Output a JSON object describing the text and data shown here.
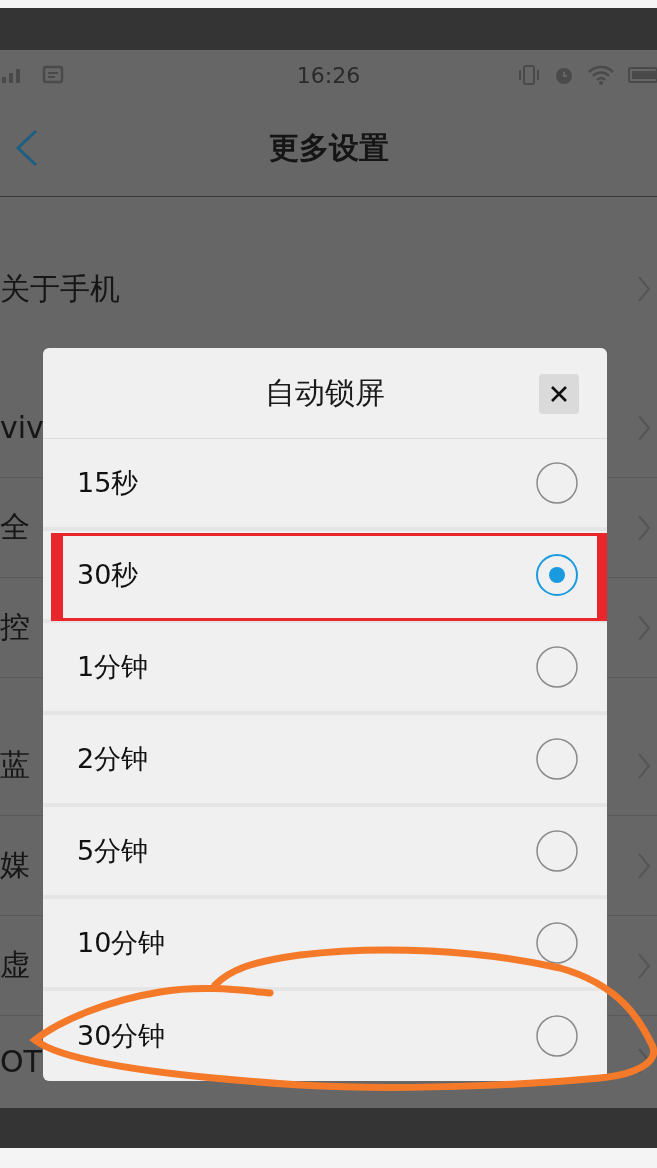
{
  "status_bar": {
    "time": "16:26"
  },
  "nav": {
    "title": "更多设置"
  },
  "groups": [
    {
      "rows": [
        {
          "label": "关于手机"
        }
      ]
    },
    {
      "rows": [
        {
          "label": "viv"
        },
        {
          "label": "全"
        },
        {
          "label": "控"
        }
      ]
    },
    {
      "rows": [
        {
          "label": "蓝"
        },
        {
          "label": "媒"
        },
        {
          "label": "虚"
        },
        {
          "label": "OT"
        }
      ]
    }
  ],
  "dialog": {
    "title": "自动锁屏",
    "options": [
      {
        "label": "15秒",
        "selected": false,
        "highlighted": false
      },
      {
        "label": "30秒",
        "selected": true,
        "highlighted": true
      },
      {
        "label": "1分钟",
        "selected": false,
        "highlighted": false
      },
      {
        "label": "2分钟",
        "selected": false,
        "highlighted": false
      },
      {
        "label": "5分钟",
        "selected": false,
        "highlighted": false
      },
      {
        "label": "10分钟",
        "selected": false,
        "highlighted": false
      },
      {
        "label": "30分钟",
        "selected": false,
        "highlighted": false
      }
    ]
  }
}
